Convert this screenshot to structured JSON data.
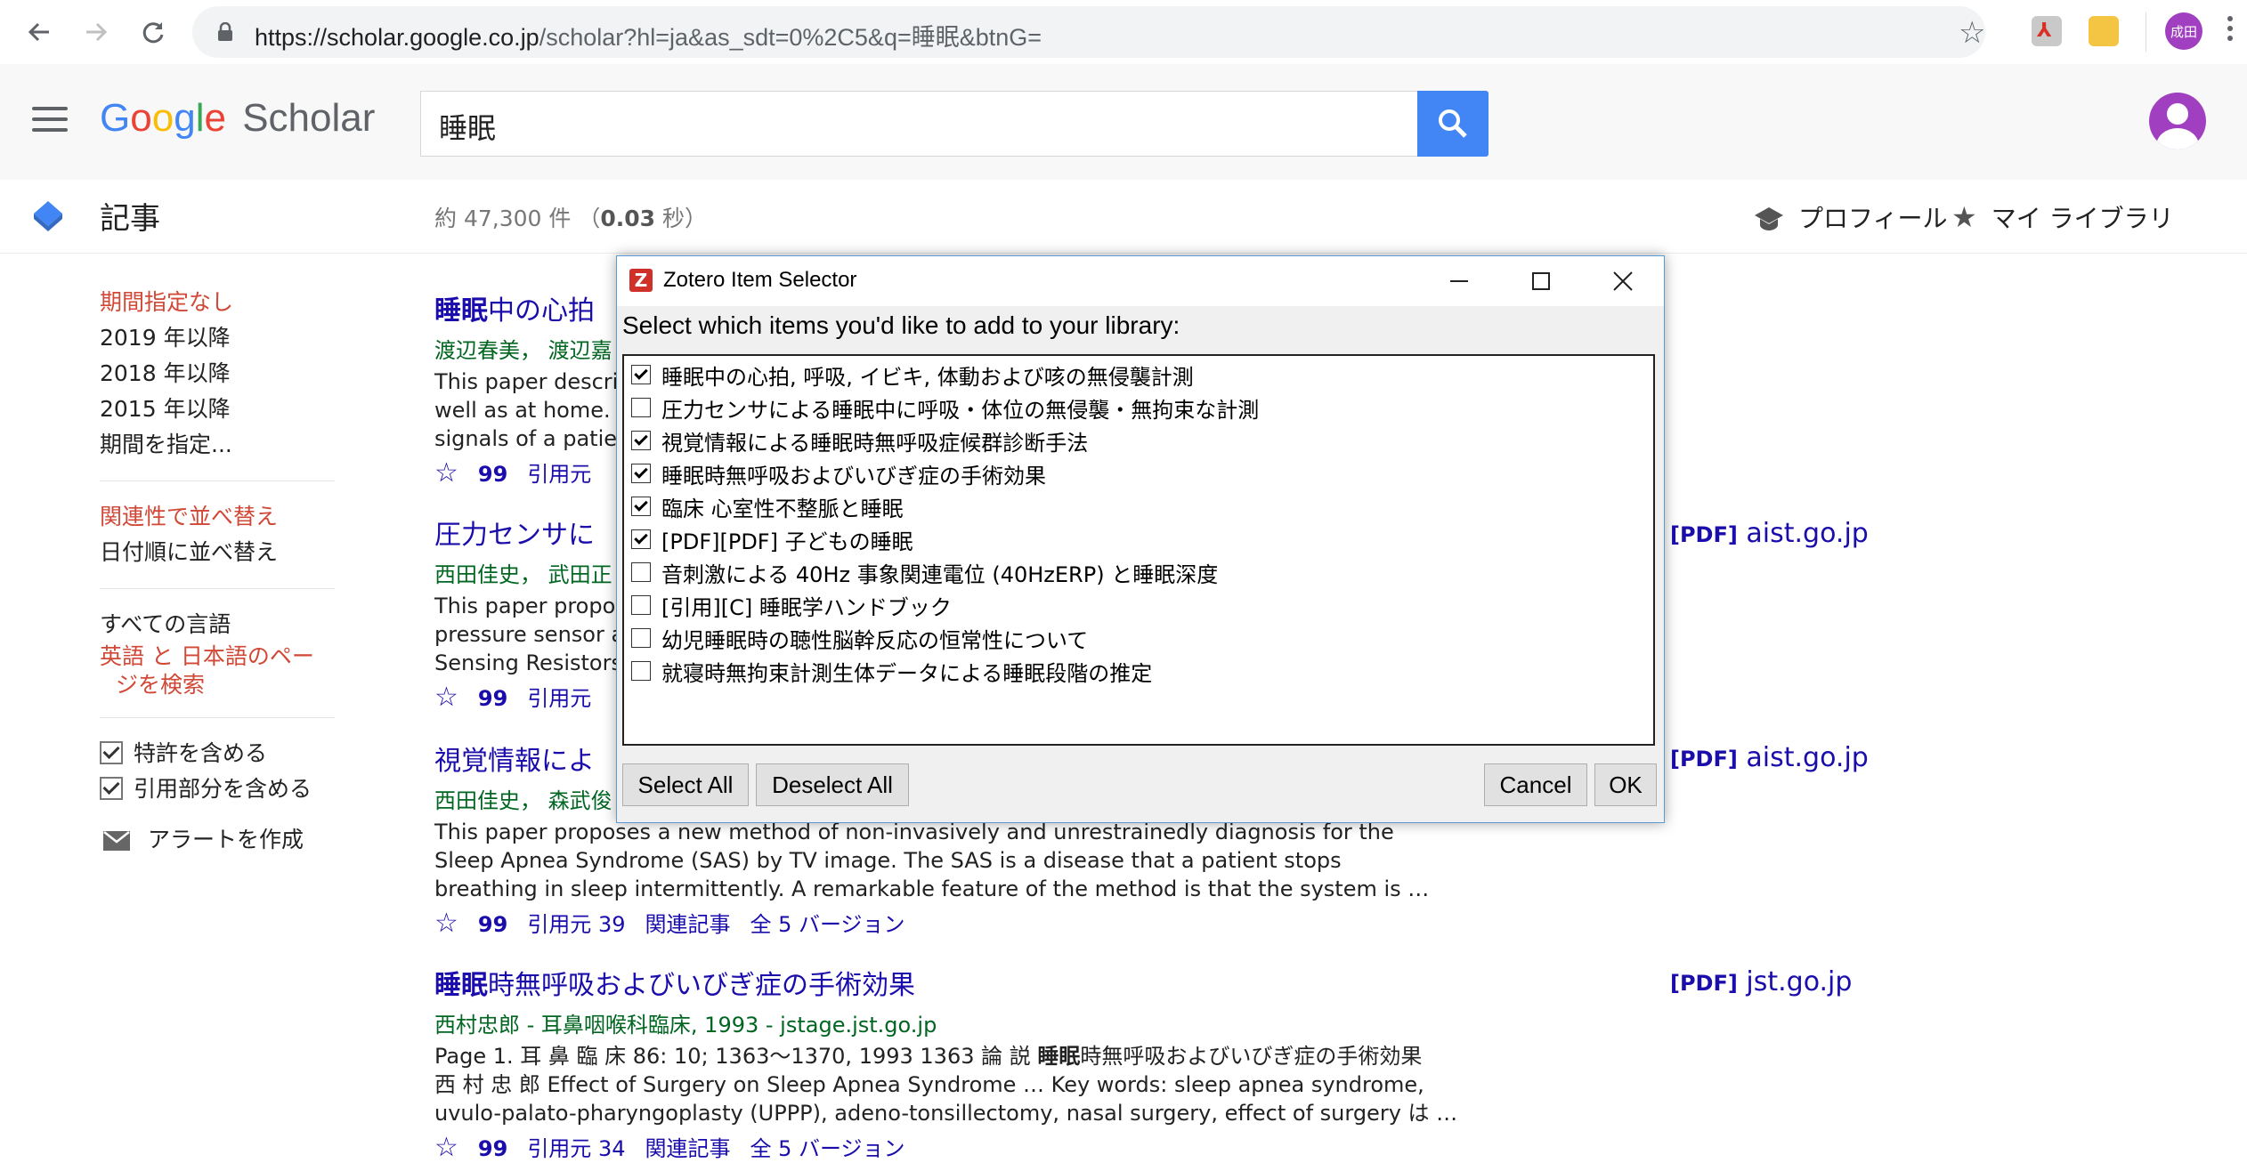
{
  "browser": {
    "url_host": "https://scholar.google.co.jp",
    "url_path": "/scholar?hl=ja&as_sdt=0%2C5&q=睡眠&btnG=",
    "profile_initials": "成田"
  },
  "header": {
    "logo_google": "Google",
    "logo_scholar": "Scholar",
    "search_query": "睡眠"
  },
  "subheader": {
    "section_title": "記事",
    "stats_prefix": "約 47,300 件 （",
    "stats_time": "0.03",
    "stats_suffix": " 秒）",
    "profile_label": "プロフィール",
    "library_label": "マイ ライブラリ"
  },
  "sidebar": {
    "time_filters": [
      "期間指定なし",
      "2019 年以降",
      "2018 年以降",
      "2015 年以降",
      "期間を指定..."
    ],
    "sort_options": [
      "関連性で並べ替え",
      "日付順に並べ替え"
    ],
    "lang_all": "すべての言語",
    "lang_search_line1": "英語 と 日本語のペー",
    "lang_search_line2": "ジを検索",
    "include_patents": "特許を含める",
    "include_citations": "引用部分を含める",
    "create_alert": "アラートを作成"
  },
  "results": [
    {
      "title_bold": "睡眠",
      "title_rest": "中の心拍",
      "meta": "渡辺春美， 渡辺嘉",
      "snippet": [
        "This paper descri",
        "well as at home. T",
        "signals of a patien"
      ],
      "cited": "引用元"
    },
    {
      "title_bold": "",
      "title_rest": "圧力センサに",
      "meta": "西田佳史， 武田正",
      "snippet": [
        "This paper propos",
        "pressure sensor a",
        "Sensing Resistors"
      ],
      "cited": "引用元",
      "side_tag": "[PDF]",
      "side_domain": "aist.go.jp"
    },
    {
      "title_bold": "",
      "title_rest": "視覚情報によ",
      "meta": "西田佳史， 森武俊",
      "snippet": [
        "This paper proposes a new method of non-invasively and unrestrainedly diagnosis for the",
        "Sleep Apnea Syndrome (SAS) by TV image. The SAS is a disease that a patient stops",
        "breathing in sleep intermittently. A remarkable feature of the method is that the system is …"
      ],
      "cited": "引用元 39",
      "related": "関連記事",
      "versions": "全 5 バージョン",
      "side_tag": "[PDF]",
      "side_domain": "aist.go.jp"
    },
    {
      "title_bold": "睡眠",
      "title_rest": "時無呼吸およびいびぎ症の手術効果",
      "meta": "西村忠郎 - 耳鼻咽喉科臨床, 1993 - jstage.jst.go.jp",
      "snippet_a": "Page 1. 耳 鼻 臨 床 86: 10; 1363〜1370, 1993 1363 論 説 ",
      "snippet_bold": "睡眠",
      "snippet_b": "時無呼吸およびいびぎ症の手術効果",
      "snippet2": "西 村 忠 郎 Effect of Surgery on Sleep Apnea Syndrome … Key words: sleep apnea syndrome,",
      "snippet3": "uvulo-palato-pharyngoplasty (UPPP), adeno-tonsillectomy, nasal surgery, effect of surgery は …",
      "cited": "引用元 34",
      "related": "関連記事",
      "versions": "全 5 バージョン",
      "side_tag": "[PDF]",
      "side_domain": "jst.go.jp"
    }
  ],
  "icons": {
    "star": "☆",
    "quote": "99"
  },
  "dialog": {
    "title": "Zotero Item Selector",
    "prompt": "Select which items you'd like to add to your library:",
    "items": [
      {
        "label": "睡眠中の心拍, 呼吸, イビキ, 体動および咳の無侵襲計測",
        "checked": true
      },
      {
        "label": "圧力センサによる睡眠中に呼吸・体位の無侵襲・無拘束な計測",
        "checked": false
      },
      {
        "label": "視覚情報による睡眠時無呼吸症候群診断手法",
        "checked": true
      },
      {
        "label": "睡眠時無呼吸およびいびぎ症の手術効果",
        "checked": true
      },
      {
        "label": "臨床 心室性不整脈と睡眠",
        "checked": true
      },
      {
        "label": "[PDF][PDF] 子どもの睡眠",
        "checked": true
      },
      {
        "label": "音刺激による 40Hz 事象関連電位 (40HzERP) と睡眠深度",
        "checked": false
      },
      {
        "label": "[引用][C] 睡眠学ハンドブック",
        "checked": false
      },
      {
        "label": "幼児睡眠時の聴性脳幹反応の恒常性について",
        "checked": false
      },
      {
        "label": "就寝時無拘束計測生体データによる睡眠段階の推定",
        "checked": false
      }
    ],
    "select_all": "Select All",
    "deselect_all": "Deselect All",
    "cancel": "Cancel",
    "ok": "OK"
  },
  "colors": {
    "link_blue": "#1a0dab",
    "meta_green": "#006621",
    "active_red": "#d14836",
    "search_blue": "#4285f4",
    "avatar_purple": "#a040c0"
  }
}
